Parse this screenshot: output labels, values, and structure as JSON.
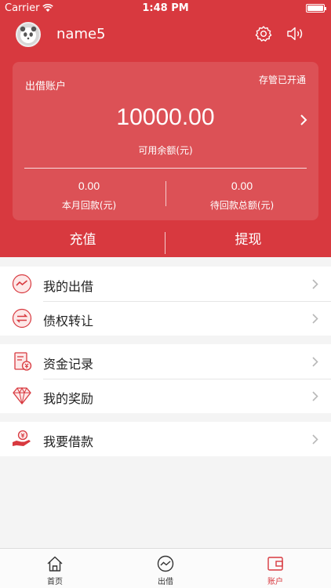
{
  "status_bar": {
    "carrier": "Carrier",
    "time": "1:48 PM"
  },
  "header": {
    "username": "name5"
  },
  "account_card": {
    "title": "出借账户",
    "status": "存管已开通",
    "balance": "10000.00",
    "balance_label": "可用余额(元)",
    "stats": [
      {
        "value": "0.00",
        "label": "本月回款(元)"
      },
      {
        "value": "0.00",
        "label": "待回款总额(元)"
      }
    ]
  },
  "actions": {
    "recharge": "充值",
    "withdraw": "提现"
  },
  "menu_groups": [
    [
      {
        "label": "我的出借",
        "icon": "trend-chart-icon"
      },
      {
        "label": "债权转让",
        "icon": "transfer-icon"
      }
    ],
    [
      {
        "label": "资金记录",
        "icon": "fund-record-icon"
      },
      {
        "label": "我的奖励",
        "icon": "diamond-icon"
      }
    ],
    [
      {
        "label": "我要借款",
        "icon": "loan-hand-icon"
      }
    ]
  ],
  "tabs": [
    {
      "label": "首页",
      "icon": "home-icon",
      "active": false
    },
    {
      "label": "出借",
      "icon": "trend-icon",
      "active": false
    },
    {
      "label": "账户",
      "icon": "wallet-icon",
      "active": true
    }
  ],
  "colors": {
    "brand_red": "#d8393f",
    "background": "#f4f4f4"
  }
}
